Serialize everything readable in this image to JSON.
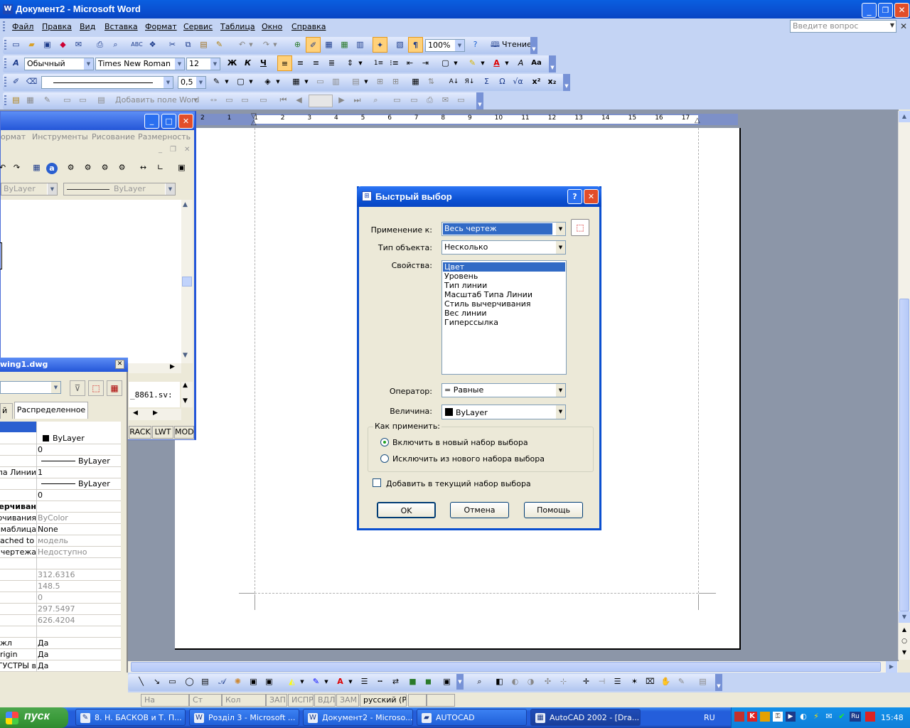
{
  "word": {
    "title": "Документ2 - Microsoft Word",
    "menu": [
      "Файл",
      "Правка",
      "Вид",
      "Вставка",
      "Формат",
      "Сервис",
      "Таблица",
      "Окно",
      "Справка"
    ],
    "ask_placeholder": "Введите вопрос",
    "zoom": "100%",
    "reading_label": "Чтение",
    "style": "Обычный",
    "font": "Times New Roman",
    "font_size": "12",
    "line_width": "0,5",
    "add_field_label": "Добавить поле Word",
    "ruler_numbers": [
      "2",
      "1",
      "1",
      "2",
      "3",
      "4",
      "5",
      "6",
      "7",
      "8",
      "9",
      "10",
      "11",
      "12",
      "13",
      "14",
      "15",
      "16",
      "17"
    ],
    "status": [
      "На",
      "Ст",
      "Кол",
      "ЗАП",
      "ИСПР",
      "ВДЛ",
      "ЗАМ",
      "русский (Ро"
    ]
  },
  "autocad": {
    "menu": [
      "ормат",
      "Инструменты",
      "Рисование",
      "Размерность"
    ],
    "layer1": "ByLayer",
    "layer2": "ByLayer",
    "cmd_text": "_8861.sv:",
    "status_buttons": [
      "RACK",
      "LWT",
      "MOD"
    ]
  },
  "properties": {
    "title": "wing1.dwg",
    "tab_left": "й",
    "tab_right": "Распределенное",
    "rows": [
      {
        "name": "",
        "value": "ByLayer",
        "swatch": true,
        "gray": false
      },
      {
        "name": "",
        "value": "0",
        "gray": false
      },
      {
        "name": "",
        "value": "ByLayer",
        "line": true,
        "gray": false
      },
      {
        "name": "па Линии",
        "value": "1",
        "gray": false
      },
      {
        "name": "",
        "value": "ByLayer",
        "line": true,
        "gray": false
      },
      {
        "name": "",
        "value": "0",
        "gray": false
      },
      {
        "name": "черчиван",
        "value": "",
        "bold": true,
        "gray": false
      },
      {
        "name": "рчивания",
        "value": "ByColor",
        "gray": true
      },
      {
        "name": "я маблица",
        "value": "None",
        "gray": false
      },
      {
        "name": "ached to",
        "value": "модель",
        "gray": true
      },
      {
        "name": "ы чертежа",
        "value": "Недоступно",
        "gray": true
      },
      {
        "name": "",
        "value": "",
        "gray": true
      },
      {
        "name": "",
        "value": "312.6316",
        "gray": true
      },
      {
        "name": "",
        "value": "148.5",
        "gray": true
      },
      {
        "name": "",
        "value": "0",
        "gray": true
      },
      {
        "name": "",
        "value": "297.5497",
        "gray": true
      },
      {
        "name": "",
        "value": "626.4204",
        "gray": true
      },
      {
        "name": "",
        "value": "",
        "gray": false
      },
      {
        "name": "жл",
        "value": "Да",
        "gray": false
      },
      {
        "name": "rigin",
        "value": "Да",
        "gray": false
      },
      {
        "name": "ГУСТРЫ в",
        "value": "Да",
        "gray": false
      }
    ]
  },
  "dialog": {
    "title": "Быстрый выбор",
    "apply_label": "Применение к:",
    "apply_value": "Весь чертеж",
    "object_type_label": "Тип объекта:",
    "object_type_value": "Несколько",
    "properties_label": "Свойства:",
    "properties": [
      "Цвет",
      "Уровень",
      "Тип линии",
      "Масштаб Типа Линии",
      "Стиль вычерчивания",
      "Вес линии",
      "Гиперссылка"
    ],
    "operator_label": "Оператор:",
    "operator_value": "= Равные",
    "value_label": "Величина:",
    "value_value": "ByLayer",
    "how_label": "Как применить:",
    "radio1": "Включить в новый набор выбора",
    "radio2": "Исключить из нового набора выбора",
    "append_label": "Добавить в текущий набор выбора",
    "ok": "OK",
    "cancel": "Отмена",
    "help": "Помощь"
  },
  "taskbar": {
    "start": "пуск",
    "items": [
      "8. Н. БАСКОВ и Т. П...",
      "Розділ 3 - Microsoft ...",
      "Документ2 - Microso...",
      "AUTOCAD",
      "AutoCAD 2002 - [Dra..."
    ],
    "lang": "RU",
    "clock": "15:48"
  },
  "colors": {
    "title_blue": "#0a5fe0",
    "taskbar_blue": "#245edb",
    "start_green": "#3c9c3c",
    "page_bg": "#8c96a8"
  }
}
